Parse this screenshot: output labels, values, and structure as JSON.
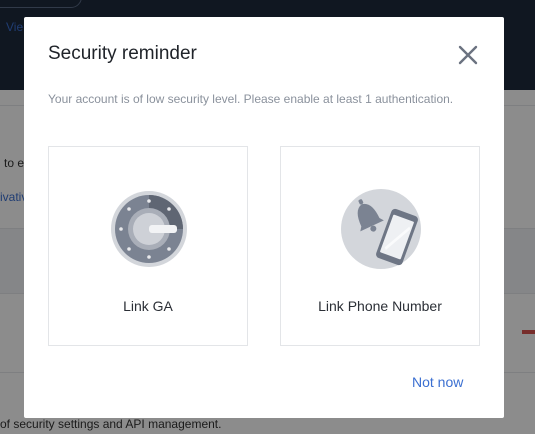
{
  "background": {
    "view_link": "Vie",
    "text_line_1": "to e",
    "text_line_2": "ivativ",
    "footer_text": "of security settings and API management."
  },
  "modal": {
    "title": "Security reminder",
    "description": "Your account is of low security level. Please enable at least 1 authentication.",
    "close_icon": "close-icon",
    "options": [
      {
        "label": "Link GA",
        "icon": "google-authenticator-icon"
      },
      {
        "label": "Link Phone Number",
        "icon": "phone-bell-icon"
      }
    ],
    "dismiss_label": "Not now"
  },
  "colors": {
    "accent": "#3b6fd1",
    "header_dark": "#1e2a3c",
    "icon_gray": "#7b8392",
    "icon_bg": "#d3d6db"
  }
}
